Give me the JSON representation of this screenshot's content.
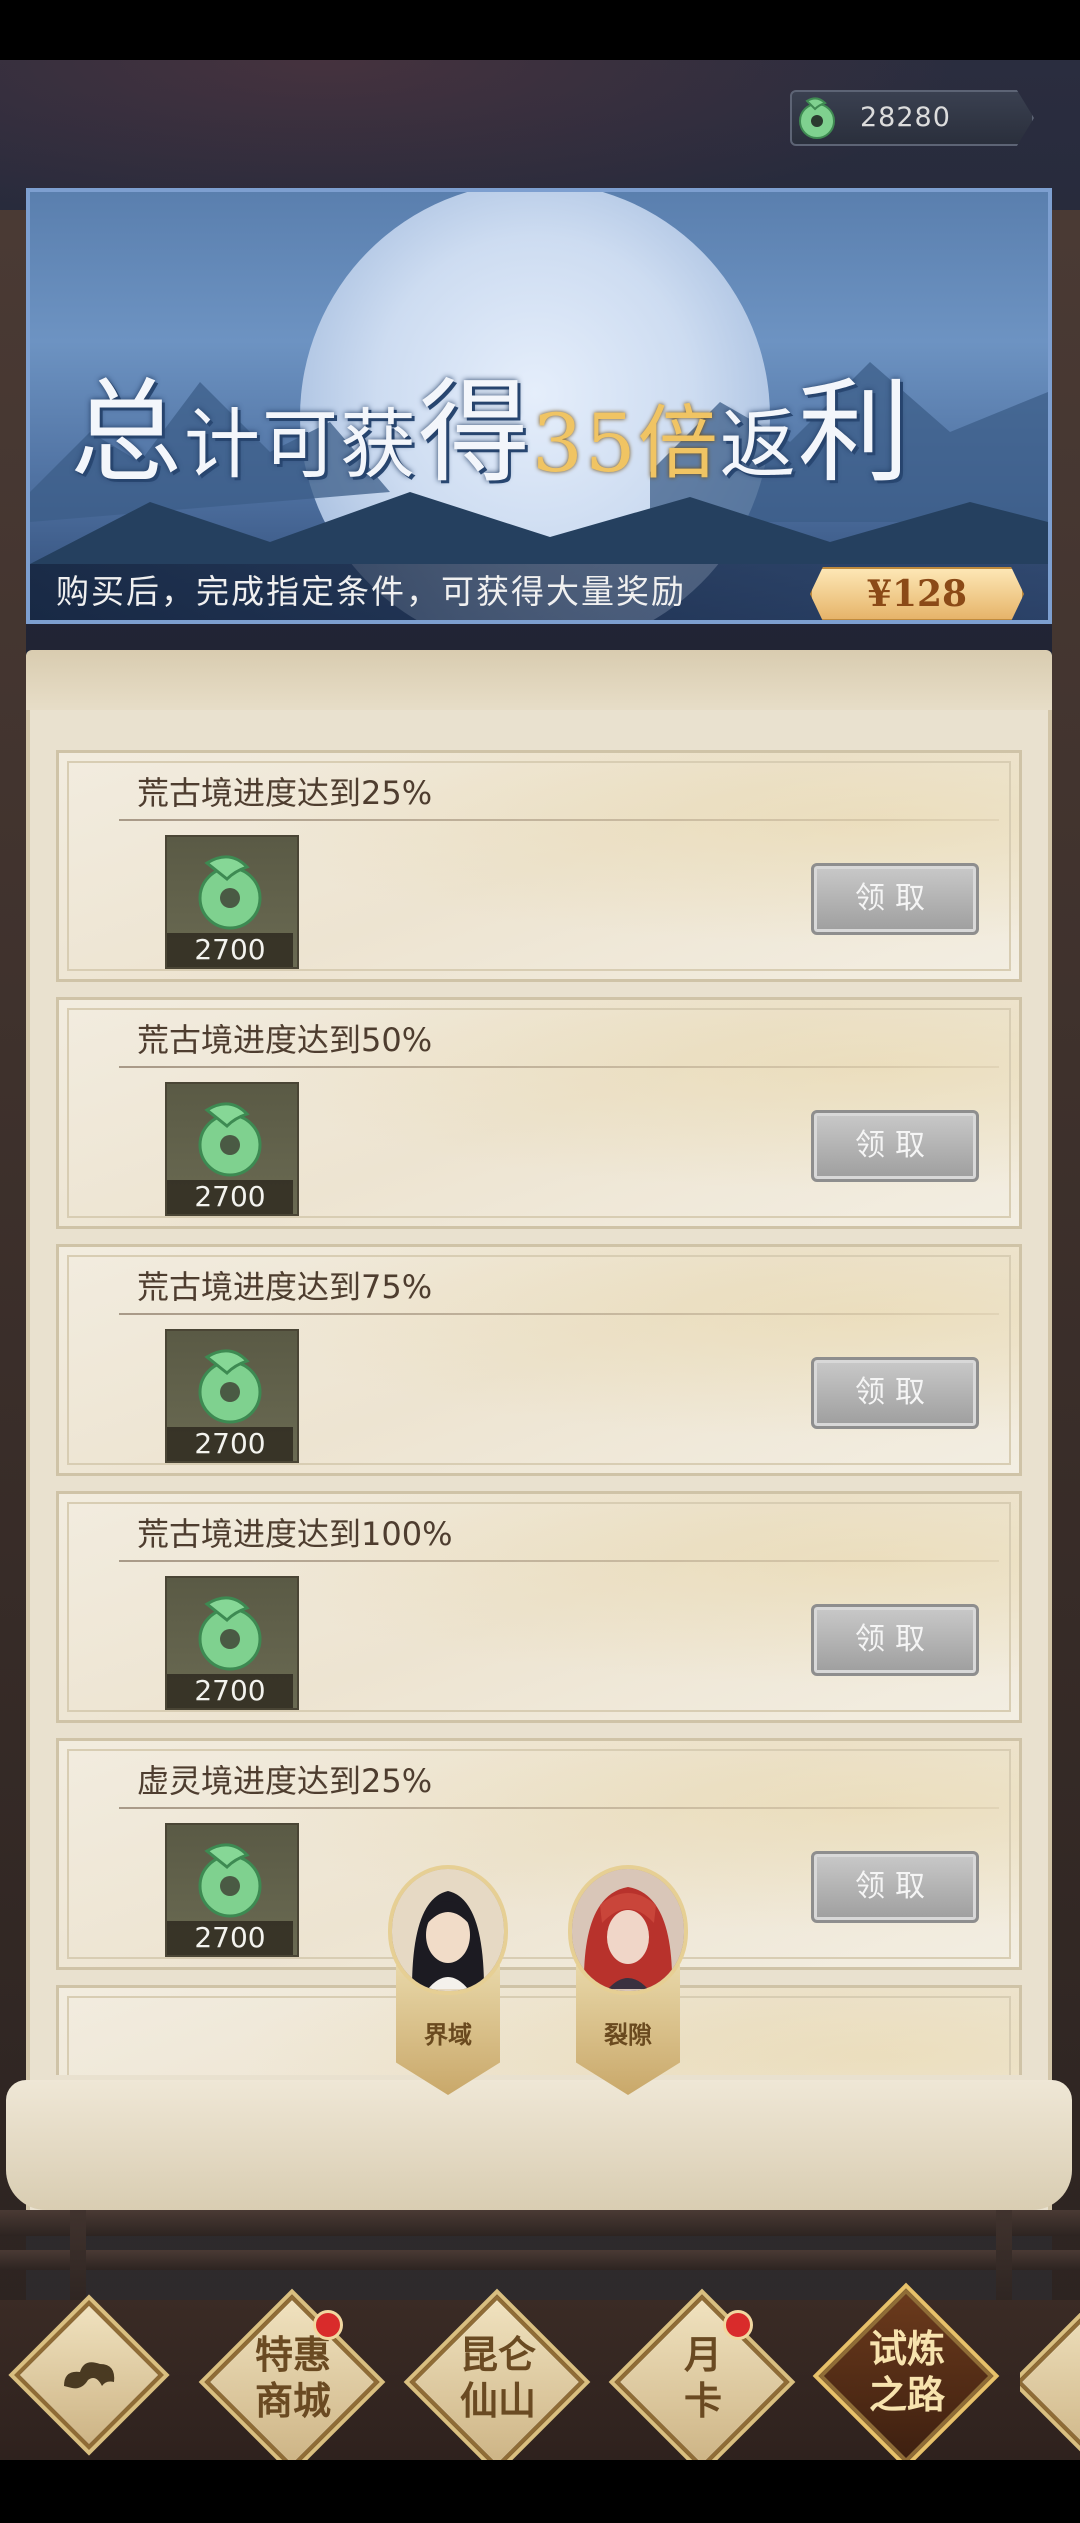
{
  "currency": {
    "icon": "jade-icon",
    "value": "28280"
  },
  "banner": {
    "title_a": "总",
    "title_b": "计可获",
    "title_c": "得",
    "title_num": "35倍",
    "title_d": "返",
    "title_e": "利",
    "subtitle": "购买后，完成指定条件，可获得大量奖励",
    "price": "¥128"
  },
  "tasks": [
    {
      "title": "荒古境进度达到25%",
      "reward_icon": "jade-icon",
      "reward_count": "2700",
      "button": "领取"
    },
    {
      "title": "荒古境进度达到50%",
      "reward_icon": "jade-icon",
      "reward_count": "2700",
      "button": "领取"
    },
    {
      "title": "荒古境进度达到75%",
      "reward_icon": "jade-icon",
      "reward_count": "2700",
      "button": "领取"
    },
    {
      "title": "荒古境进度达到100%",
      "reward_icon": "jade-icon",
      "reward_count": "2700",
      "button": "领取"
    },
    {
      "title": "虚灵境进度达到25%",
      "reward_icon": "jade-icon",
      "reward_count": "2700",
      "button": "领取"
    }
  ],
  "characters": [
    {
      "name": "界域"
    },
    {
      "name": "裂隙"
    }
  ],
  "nav": [
    {
      "label": "",
      "icon": "cloud-icon"
    },
    {
      "label": "特惠\n商城",
      "badge": true
    },
    {
      "label": "昆仑\n仙山",
      "badge": false
    },
    {
      "label": "月\n卡",
      "badge": true
    },
    {
      "label": "试炼\n之路",
      "badge": false,
      "active": true
    }
  ],
  "colors": {
    "accent_gold": "#f0c463",
    "badge_red": "#d92b2b"
  }
}
